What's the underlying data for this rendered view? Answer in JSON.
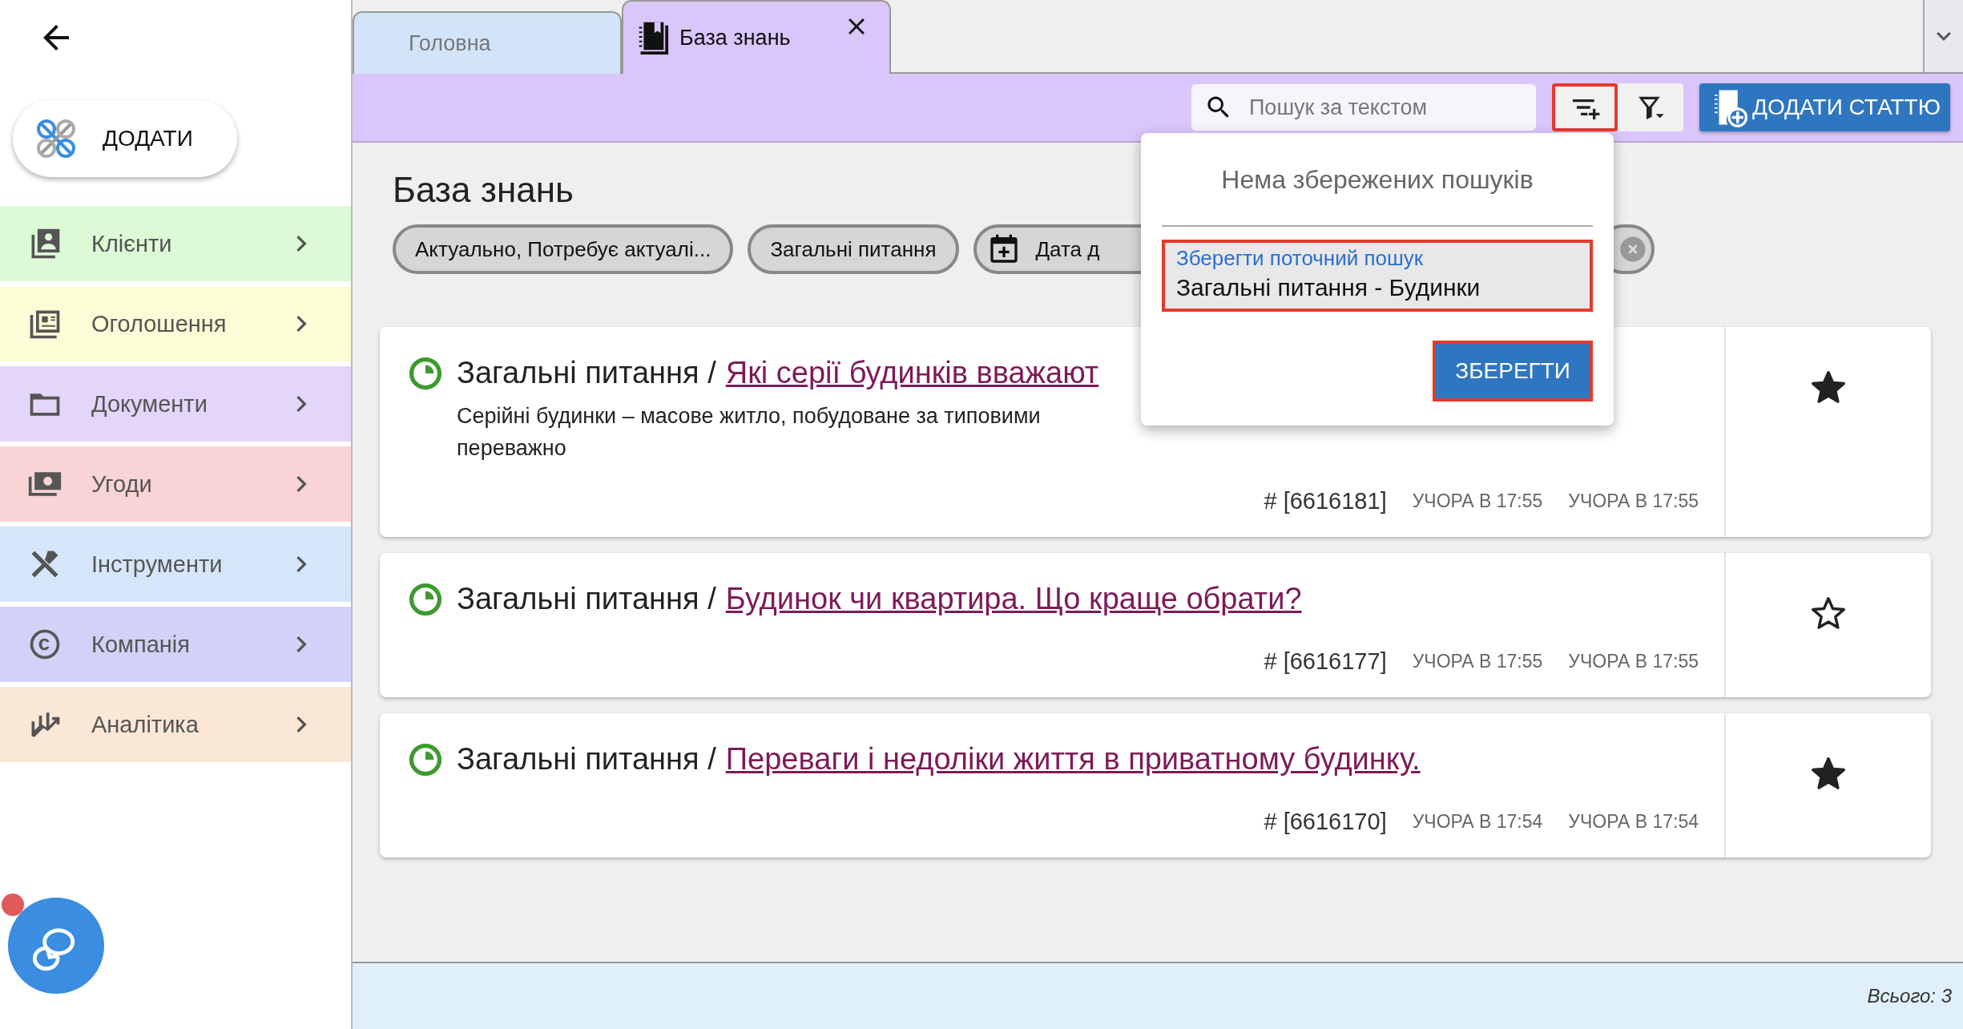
{
  "sidebar": {
    "add_button": "ДОДАТИ",
    "items": [
      {
        "label": "Клієнти",
        "color": "#dcfad6"
      },
      {
        "label": "Оголошення",
        "color": "#fcfcd6"
      },
      {
        "label": "Документи",
        "color": "#e3d6fa"
      },
      {
        "label": "Угоди",
        "color": "#f8d4d4"
      },
      {
        "label": "Інструменти",
        "color": "#d6e6fa"
      },
      {
        "label": "Компанія",
        "color": "#d2d2f8"
      },
      {
        "label": "Аналітика",
        "color": "#fae7d6"
      }
    ],
    "chat": {
      "unread": true
    }
  },
  "tabs": [
    {
      "label": "Головна",
      "selected": false,
      "closable": false
    },
    {
      "label": "База знань",
      "selected": true,
      "closable": true
    }
  ],
  "toolbar": {
    "search": {
      "placeholder": "Пошук за текстом"
    },
    "save_filter_highlighted": true,
    "add_button": "ДОДАТИ СТАТТЮ"
  },
  "page_title": "База знань",
  "chips": [
    {
      "kind": "text",
      "label": "Актуально, Потребує актуалі..."
    },
    {
      "kind": "text",
      "label": "Загальні питання"
    },
    {
      "kind": "date",
      "label": "Дата д"
    },
    {
      "kind": "clear"
    }
  ],
  "articles": [
    {
      "category": "Загальні питання /",
      "title": "Які серії будинків вважают",
      "description": [
        "Серійні будинки – масове житло, побудоване за типовими",
        "переважно"
      ],
      "id": "# [6616181]",
      "created": "УЧОРА В 17:55",
      "updated": "УЧОРА В 17:55",
      "starred": true
    },
    {
      "category": "Загальні питання /",
      "title": "Будинок чи квартира. Що краще обрати?",
      "id": "# [6616177]",
      "created": "УЧОРА В 17:55",
      "updated": "УЧОРА В 17:55",
      "starred": false
    },
    {
      "category": "Загальні питання /",
      "title": "Переваги і недоліки життя в приватному будинку.",
      "id": "# [6616170]",
      "created": "УЧОРА В 17:54",
      "updated": "УЧОРА В 17:54",
      "starred": true
    }
  ],
  "popup": {
    "empty_text": "Нема збережених пошуків",
    "field": {
      "label": "Зберегти поточний пошук",
      "value": "Загальні питання - Будинки",
      "highlighted": true
    },
    "save_button": {
      "label": "ЗБЕРЕГТИ",
      "highlighted": true
    }
  },
  "footer": {
    "total": "Всього: 3"
  }
}
